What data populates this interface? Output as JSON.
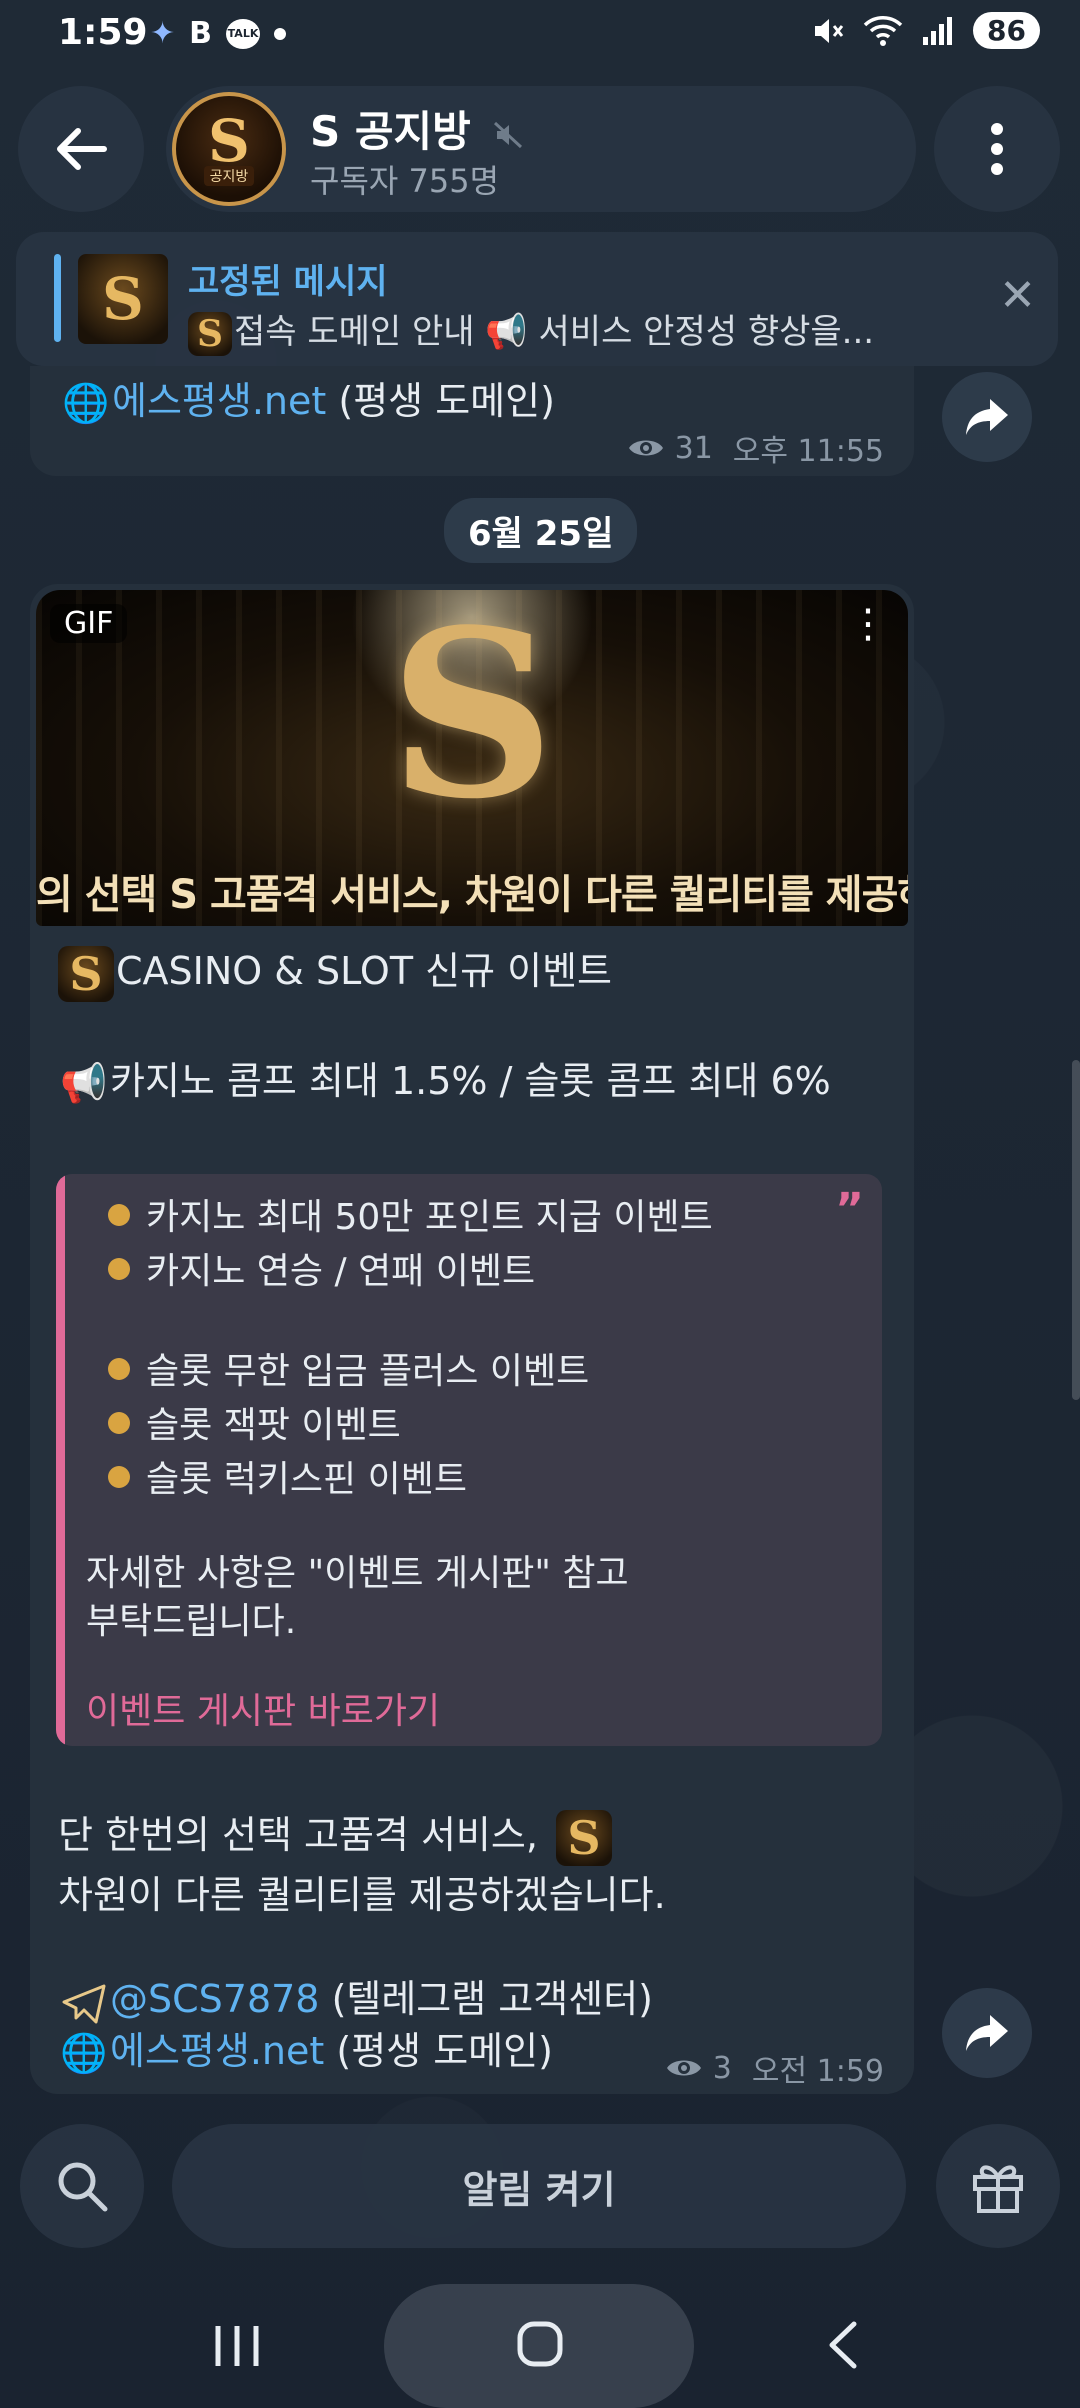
{
  "status_bar": {
    "time": "1:59",
    "kakao_label": "TALK",
    "battery": "86"
  },
  "header": {
    "back_icon": "arrow-left-icon",
    "avatar_letter": "S",
    "avatar_caption": "공지방",
    "title": "S 공지방",
    "subscribers": "구독자 755명",
    "menu_icon": "more-vertical-icon"
  },
  "pinned": {
    "title": "고정된 메시지",
    "thumb_letter": "S",
    "text": "접속 도메인 안내 📢 서비스 안정성 향상을..."
  },
  "prev_message": {
    "domain_text": "에스평생.net",
    "domain_suffix": " (평생 도메인)",
    "views": "31",
    "time": "오후 11:55"
  },
  "date_chip": "6월 25일",
  "message": {
    "gif_badge": "GIF",
    "gif_letter": "S",
    "gif_caption": "의 선택 S 고품격 서비스, 차원이 다른 퀄리티를 제공하겠",
    "line1": "CASINO & SLOT 신규 이벤트",
    "line2": "카지노 콤프 최대 1.5% / 슬롯 콤프 최대 6%",
    "quote_items_a": [
      "카지노 최대 50만 포인트 지급 이벤트",
      "카지노 연승 / 연패 이벤트"
    ],
    "quote_items_b": [
      "슬롯 무한 입금 플러스 이벤트",
      "슬롯 잭팟 이벤트",
      "슬롯 럭키스핀 이벤트"
    ],
    "quote_note_1": "자세한 사항은 \"이벤트 게시판\" 참고",
    "quote_note_2": "부탁드립니다.",
    "quote_link": "이벤트 게시판 바로가기",
    "closing_1": "단 한번의 선택 고품격 서비스,",
    "closing_2": "차원이 다른 퀄리티를 제공하겠습니다.",
    "telegram_handle": "@SCS7878",
    "telegram_suffix": " (텔레그램 고객센터)",
    "domain_text": "에스평생.net",
    "domain_suffix": " (평생 도메인)",
    "views": "3",
    "time": "오전 1:59"
  },
  "bottom": {
    "alert_button": "알림 켜기"
  },
  "colors": {
    "accent_blue": "#5fb2f0",
    "quote_pink": "#e06a98",
    "bubble": "#25303c"
  }
}
